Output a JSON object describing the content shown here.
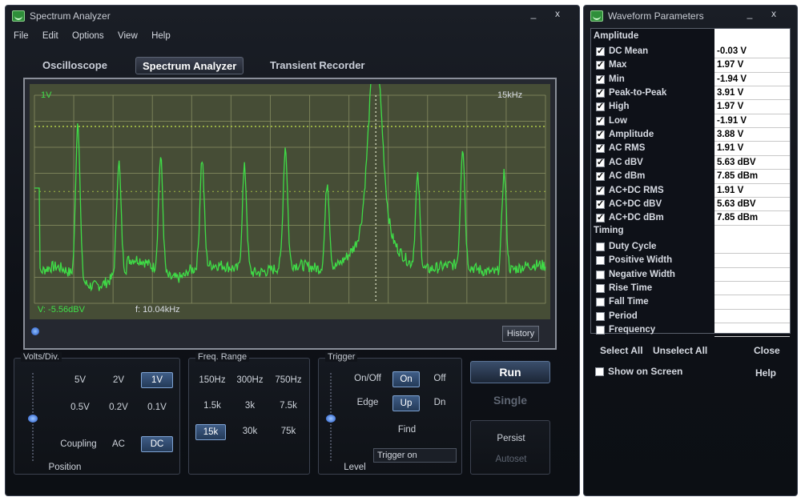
{
  "main_window": {
    "title": "Spectrum Analyzer",
    "min_glyph": "_",
    "close_glyph": "x",
    "menu": [
      "File",
      "Edit",
      "Options",
      "View",
      "Help"
    ],
    "tabs": [
      {
        "label": "Oscilloscope",
        "active": false
      },
      {
        "label": "Spectrum Analyzer",
        "active": true
      },
      {
        "label": "Transient Recorder",
        "active": false
      }
    ]
  },
  "scope": {
    "volts_label": "1V",
    "freq_label": "15kHz",
    "cursor_v_label": "V: -5.56dBV",
    "cursor_f_label": "f: 10.04kHz",
    "history_label": "History",
    "trace_color": "#3fdc47",
    "grid_color": "#8b9164",
    "marker_color": "#c8e84e"
  },
  "volts_div": {
    "title": "Volts/Div.",
    "options": [
      "5V",
      "2V",
      "1V",
      "0.5V",
      "0.2V",
      "0.1V"
    ],
    "selected": "1V",
    "coupling_label": "Coupling",
    "coupling_ac": "AC",
    "coupling_dc": "DC",
    "coupling_selected": "DC",
    "position_label": "Position"
  },
  "freq_range": {
    "title": "Freq. Range",
    "options": [
      "150Hz",
      "300Hz",
      "750Hz",
      "1.5k",
      "3k",
      "7.5k",
      "15k",
      "30k",
      "75k"
    ],
    "selected": "15k"
  },
  "trigger": {
    "title": "Trigger",
    "onoff_label": "On/Off",
    "on_label": "On",
    "off_label": "Off",
    "edge_label": "Edge",
    "up_label": "Up",
    "dn_label": "Dn",
    "find_label": "Find",
    "level_label": "Level",
    "input_value": "Trigger on"
  },
  "buttons": {
    "run": "Run",
    "single": "Single",
    "persist": "Persist",
    "autoset": "Autoset"
  },
  "params_window": {
    "title": "Waveform Parameters",
    "min_glyph": "_",
    "close_glyph": "x",
    "amplitude_header": "Amplitude",
    "timing_header": "Timing",
    "amplitude": [
      {
        "label": "DC  Mean",
        "value": "-0.03 V",
        "checked": true
      },
      {
        "label": "Max",
        "value": "1.97 V",
        "checked": true
      },
      {
        "label": "Min",
        "value": "-1.94 V",
        "checked": true
      },
      {
        "label": "Peak-to-Peak",
        "value": "3.91 V",
        "checked": true
      },
      {
        "label": "High",
        "value": "1.97 V",
        "checked": true
      },
      {
        "label": "Low",
        "value": "-1.91 V",
        "checked": true
      },
      {
        "label": "Amplitude",
        "value": "3.88 V",
        "checked": true
      },
      {
        "label": "AC RMS",
        "value": "1.91 V",
        "checked": true
      },
      {
        "label": "AC dBV",
        "value": "5.63 dBV",
        "checked": true
      },
      {
        "label": "AC dBm",
        "value": "7.85 dBm",
        "checked": true
      },
      {
        "label": "AC+DC RMS",
        "value": "1.91 V",
        "checked": true
      },
      {
        "label": "AC+DC dBV",
        "value": "5.63 dBV",
        "checked": true
      },
      {
        "label": "AC+DC dBm",
        "value": "7.85 dBm",
        "checked": true
      }
    ],
    "timing": [
      {
        "label": "Duty Cycle",
        "value": "",
        "checked": false
      },
      {
        "label": "Positive Width",
        "value": "",
        "checked": false
      },
      {
        "label": "Negative Width",
        "value": "",
        "checked": false
      },
      {
        "label": "Rise Time",
        "value": "",
        "checked": false
      },
      {
        "label": "Fall Time",
        "value": "",
        "checked": false
      },
      {
        "label": "Period",
        "value": "",
        "checked": false
      },
      {
        "label": "Frequency",
        "value": "",
        "checked": false
      }
    ],
    "select_all": "Select All",
    "unselect_all": "Unselect All",
    "close": "Close",
    "show_on_screen": "Show on Screen",
    "show_on_screen_checked": false,
    "help": "Help"
  }
}
